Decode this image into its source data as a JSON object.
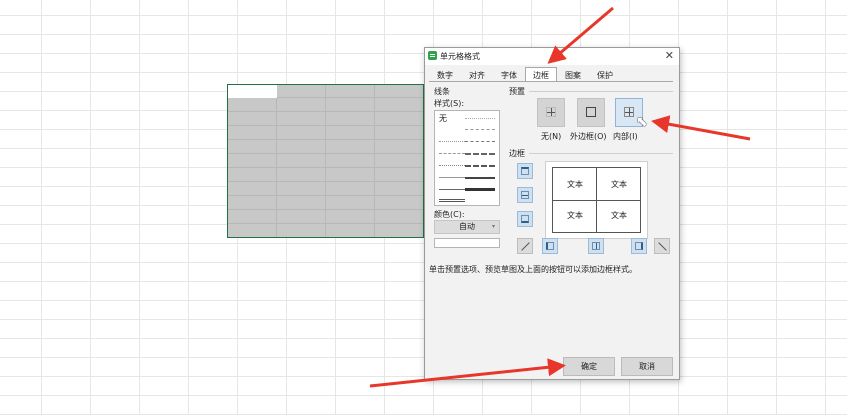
{
  "dialog": {
    "title": "单元格格式",
    "close_icon": "close-icon",
    "tabs": [
      {
        "label": "数字"
      },
      {
        "label": "对齐"
      },
      {
        "label": "字体"
      },
      {
        "label": "边框",
        "active": true
      },
      {
        "label": "图案"
      },
      {
        "label": "保护"
      }
    ],
    "line_section": {
      "group_label": "线条",
      "style_label": "样式(S):",
      "style_none": "无",
      "color_label": "颜色(C):",
      "color_value": "自动"
    },
    "preset_section": {
      "group_label": "预置",
      "labels": [
        "无(N)",
        "外边框(O)",
        "内部(I)"
      ]
    },
    "border_section": {
      "group_label": "边框",
      "preview_texts": [
        "文本",
        "文本",
        "文本",
        "文本"
      ]
    },
    "hint": "单击预置选项、预览草图及上面的按钮可以添加边框样式。",
    "buttons": {
      "ok": "确定",
      "cancel": "取消"
    }
  },
  "colors": {
    "selection_border": "#217346",
    "selection_fill": "#c8c8c8",
    "arrow": "#e8362b",
    "active_preset": "#d9e7f5"
  }
}
